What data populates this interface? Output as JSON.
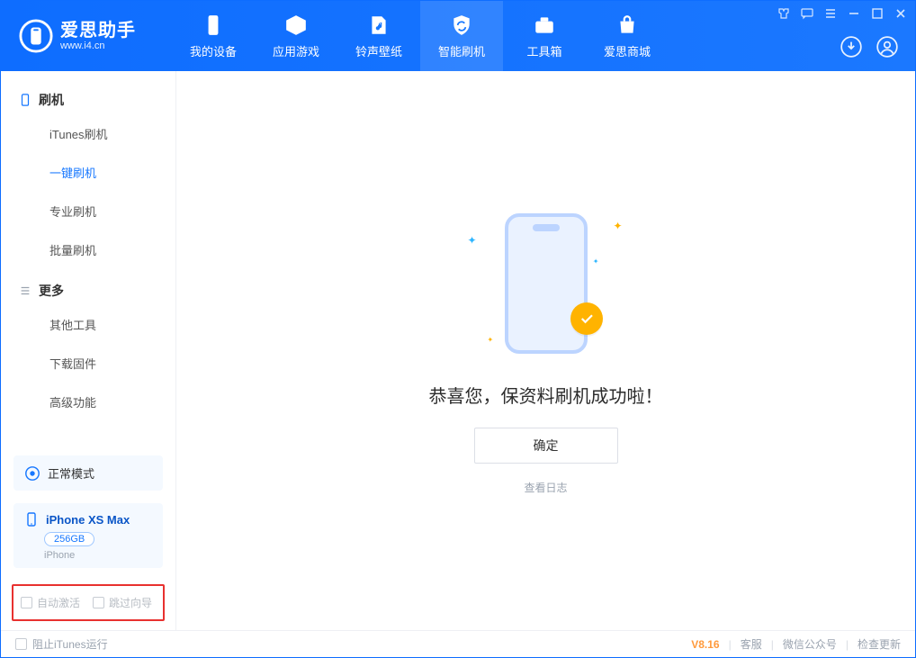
{
  "app": {
    "name_cn": "爱思助手",
    "url": "www.i4.cn"
  },
  "header": {
    "tabs": [
      {
        "label": "我的设备"
      },
      {
        "label": "应用游戏"
      },
      {
        "label": "铃声壁纸"
      },
      {
        "label": "智能刷机"
      },
      {
        "label": "工具箱"
      },
      {
        "label": "爱思商城"
      }
    ],
    "active_tab_index": 3
  },
  "sidebar": {
    "groups": [
      {
        "title": "刷机",
        "items": [
          {
            "label": "iTunes刷机"
          },
          {
            "label": "一键刷机",
            "active": true
          },
          {
            "label": "专业刷机"
          },
          {
            "label": "批量刷机"
          }
        ]
      },
      {
        "title": "更多",
        "items": [
          {
            "label": "其他工具"
          },
          {
            "label": "下载固件"
          },
          {
            "label": "高级功能"
          }
        ]
      }
    ],
    "mode_label": "正常模式",
    "device": {
      "name": "iPhone XS Max",
      "capacity": "256GB",
      "type": "iPhone"
    },
    "options": {
      "auto_activate": "自动激活",
      "skip_guide": "跳过向导"
    }
  },
  "main": {
    "success_title": "恭喜您，保资料刷机成功啦！",
    "ok_button": "确定",
    "view_log": "查看日志"
  },
  "footer": {
    "block_itunes": "阻止iTunes运行",
    "version": "V8.16",
    "links": {
      "support": "客服",
      "wechat": "微信公众号",
      "check_update": "检查更新"
    }
  },
  "colors": {
    "primary": "#1677ff",
    "accent": "#ffb300"
  }
}
